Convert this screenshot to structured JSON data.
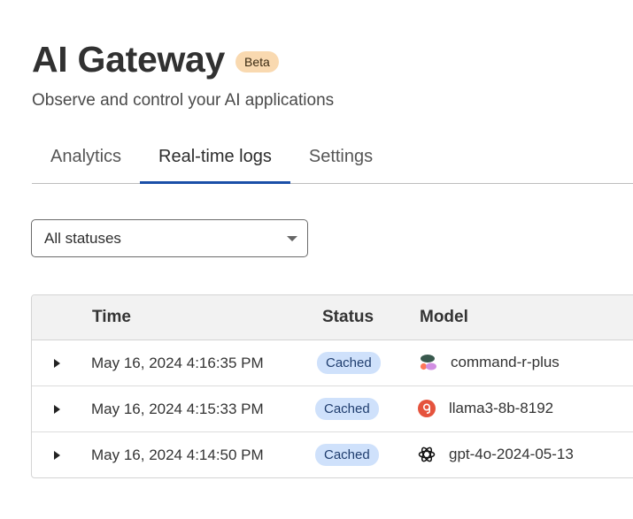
{
  "header": {
    "title": "AI Gateway",
    "badge": "Beta",
    "subtitle": "Observe and control your AI applications"
  },
  "tabs": [
    {
      "label": "Analytics",
      "active": false
    },
    {
      "label": "Real-time logs",
      "active": true
    },
    {
      "label": "Settings",
      "active": false
    }
  ],
  "filter": {
    "selected": "All statuses"
  },
  "table": {
    "columns": [
      "Time",
      "Status",
      "Model"
    ],
    "rows": [
      {
        "time": "May 16, 2024 4:16:35 PM",
        "status": "Cached",
        "model": "command-r-plus",
        "icon": "cohere-icon"
      },
      {
        "time": "May 16, 2024 4:15:33 PM",
        "status": "Cached",
        "model": "llama3-8b-8192",
        "icon": "groq-icon"
      },
      {
        "time": "May 16, 2024 4:14:50 PM",
        "status": "Cached",
        "model": "gpt-4o-2024-05-13",
        "icon": "openai-icon"
      }
    ]
  },
  "colors": {
    "accent": "#1b4fa8",
    "beta_badge": "#f9d9b0",
    "cached_badge": "#cfe1fb"
  }
}
